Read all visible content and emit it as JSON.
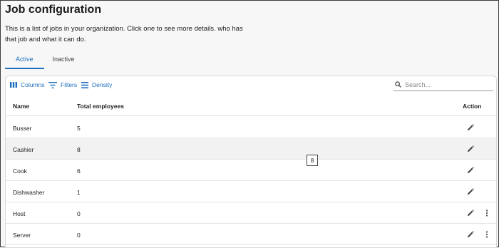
{
  "page": {
    "title": "Job configuration",
    "description": "This is a list of jobs in your organization. Click one to see more details. who has that job and what it can do."
  },
  "tabs": [
    {
      "label": "Active",
      "active": true
    },
    {
      "label": "Inactive",
      "active": false
    }
  ],
  "toolbar": {
    "columns_label": "Columns",
    "filters_label": "Filters",
    "density_label": "Density",
    "search_placeholder": "Search..."
  },
  "table": {
    "headers": {
      "name": "Name",
      "total": "Total employees",
      "action": "Action"
    },
    "rows": [
      {
        "name": "Busser",
        "total": "5",
        "more": false
      },
      {
        "name": "Cashier",
        "total": "8",
        "more": false
      },
      {
        "name": "Cook",
        "total": "6",
        "more": false
      },
      {
        "name": "Dishwasher",
        "total": "1",
        "more": false
      },
      {
        "name": "Host",
        "total": "0",
        "more": true
      },
      {
        "name": "Server",
        "total": "0",
        "more": true
      }
    ]
  },
  "tooltip": {
    "text": "8"
  },
  "colors": {
    "accent": "#1f6fbf",
    "hover_row": "#f2f2f2",
    "border": "#d9d9d9"
  },
  "icons": {
    "columns": "columns-icon",
    "filters": "filter-icon",
    "density": "density-icon",
    "search": "search-icon",
    "edit": "pencil-icon",
    "more": "more-vertical-icon"
  }
}
